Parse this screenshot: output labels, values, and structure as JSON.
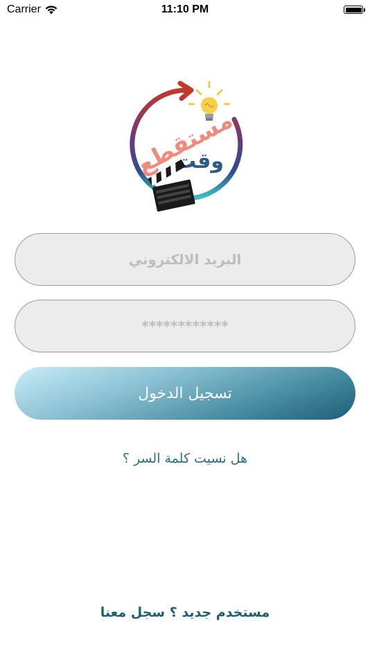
{
  "status_bar": {
    "carrier": "Carrier",
    "time": "11:10 PM",
    "battery_level": 1.0
  },
  "logo": {
    "word_top": "مستقطع",
    "word_bottom": "وقت",
    "icons": [
      "lightbulb-icon",
      "clapperboard-icon",
      "circular-arrow-icon"
    ]
  },
  "form": {
    "email": {
      "placeholder": "البريد الالكتروني",
      "value": ""
    },
    "password": {
      "placeholder": "************",
      "value": ""
    },
    "login_label": "تسجيل الدخول",
    "forgot_label": "هل نسيت كلمة السر ؟"
  },
  "register": {
    "question": "مستخدم جديد ؟",
    "action": "سجل معنا"
  },
  "colors": {
    "accent": "#1f5f74",
    "field_bg": "#ececec",
    "button_gradient_start": "#c8ecf7",
    "button_gradient_end": "#1d5e74"
  }
}
